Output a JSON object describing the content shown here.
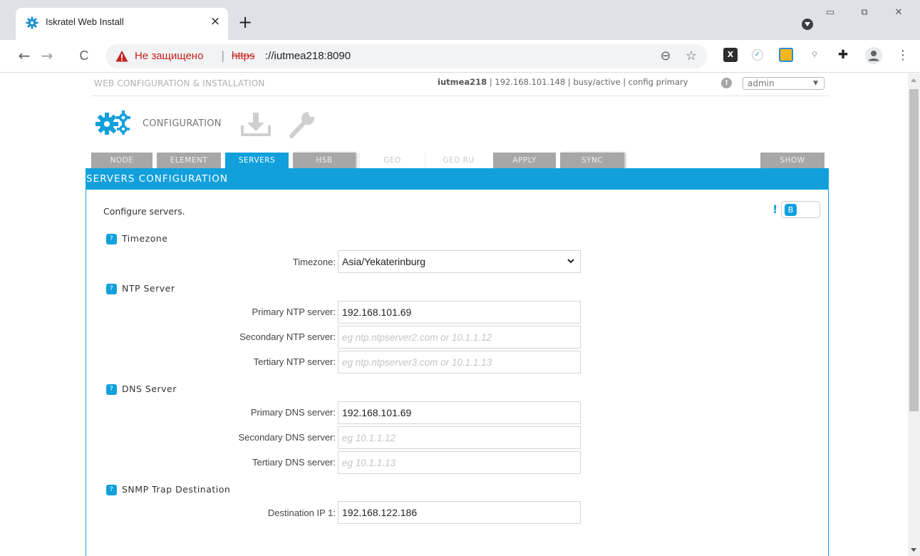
{
  "browser": {
    "tab_title": "Iskratel Web Install",
    "tab_close": "×",
    "new_tab": "+",
    "back": "←",
    "forward": "→",
    "reload": "C",
    "insecure_label": "Не защищено",
    "url_separator": "|",
    "url_scheme": "https",
    "url_host": "://iutmea218:8090",
    "zoom_icon": "⊖",
    "bookmark_icon": "☆",
    "window_controls": [
      "▭",
      "⧉",
      "✕"
    ],
    "menu_icon": "⋮"
  },
  "header": {
    "app_title": "WEB CONFIGURATION & INSTALLATION",
    "host_name": "iutmea218",
    "status": " | 192.168.101.148 | busy/active | config primary",
    "info_icon": "!",
    "user": "admin",
    "user_arrow": "▼"
  },
  "toolbar": {
    "configuration_label": "CONFIGURATION"
  },
  "tabs": [
    {
      "label": "NODE"
    },
    {
      "label": "ELEMENT"
    },
    {
      "label": "SERVERS"
    },
    {
      "label": "HSB"
    },
    {
      "label": "GEO"
    },
    {
      "label": "GEO RU"
    },
    {
      "label": "APPLY"
    },
    {
      "label": "SYNC"
    },
    {
      "label": "SHOW"
    }
  ],
  "panel": {
    "title": "SERVERS CONFIGURATION",
    "description": "Configure servers.",
    "alert_mark": "!",
    "toggle_label": "B",
    "help_mark": "?"
  },
  "sections": {
    "timezone": {
      "title": "Timezone",
      "label": "Timezone:",
      "value": "Asia/Yekaterinburg",
      "chevron": "⌄"
    },
    "ntp": {
      "title": "NTP Server",
      "primary_label": "Primary NTP server:",
      "primary_value": "192.168.101.69",
      "secondary_label": "Secondary NTP server:",
      "secondary_placeholder": "eg ntp.ntpserver2.com or 10.1.1.12",
      "tertiary_label": "Tertiary NTP server:",
      "tertiary_placeholder": "eg ntp.ntpserver3.com or 10.1.1.13"
    },
    "dns": {
      "title": "DNS Server",
      "primary_label": "Primary DNS server:",
      "primary_value": "192.168.101.69",
      "secondary_label": "Secondary DNS server:",
      "secondary_placeholder": "eg 10.1.1.12",
      "tertiary_label": "Tertiary DNS server:",
      "tertiary_placeholder": "eg 10.1.1.13"
    },
    "snmp": {
      "title": "SNMP Trap Destination",
      "dest1_label": "Destination IP 1:",
      "dest1_value": "192.168.122.186"
    }
  },
  "colors": {
    "accent": "#11a0dc",
    "tab_inactive": "#a7a7a7",
    "insecure": "#c5221f"
  }
}
